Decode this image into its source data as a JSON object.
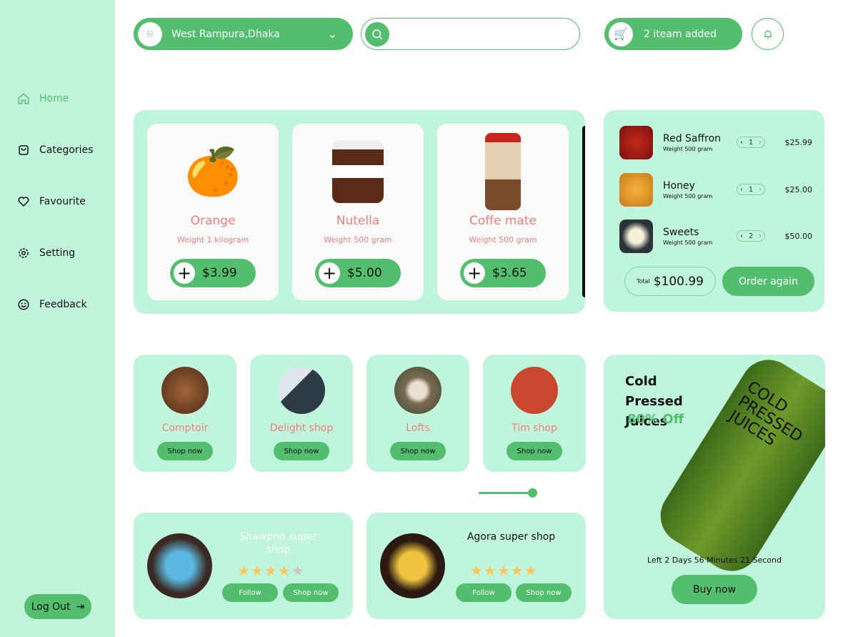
{
  "colors": {
    "accent": "#52be6e",
    "panel": "#bff5dc",
    "product_text": "#f47c7c",
    "star": "#fcc65f"
  },
  "sidebar": {
    "items": [
      {
        "label": "Home",
        "icon": "home-icon",
        "active": true
      },
      {
        "label": "Categories",
        "icon": "bag-icon"
      },
      {
        "label": "Favourite",
        "icon": "heart-icon"
      },
      {
        "label": "Setting",
        "icon": "gear-icon"
      },
      {
        "label": "Feedback",
        "icon": "smile-icon"
      }
    ],
    "logout": "Log Out"
  },
  "header": {
    "location": "West Rampura,Dhaka",
    "search_placeholder": "",
    "cart": "2 iteam added"
  },
  "products": [
    {
      "name": "Orange",
      "weight": "Weight 1 kilogram",
      "price": "$3.99"
    },
    {
      "name": "Nutella",
      "weight": "Weight 500 gram",
      "price": "$5.00"
    },
    {
      "name": "Coffe mate",
      "weight": "Weight 500 gram",
      "price": "$3.65"
    }
  ],
  "cart": {
    "items": [
      {
        "name": "Red Saffron",
        "weight": "Weight 500 gram",
        "qty": "1",
        "price": "$25.99"
      },
      {
        "name": "Honey",
        "weight": "Weight 500 gram",
        "qty": "1",
        "price": "$25.00"
      },
      {
        "name": "Sweets",
        "weight": "Weight 500 gram",
        "qty": "2",
        "price": "$50.00"
      }
    ],
    "total_label": "Total",
    "total": "$100.99",
    "order_again": "Order again"
  },
  "shops": [
    {
      "name": "Comptoir",
      "button": "Shop now"
    },
    {
      "name": "Delight shop",
      "button": "Shop now"
    },
    {
      "name": "Lofts",
      "button": "Shop now"
    },
    {
      "name": "Tim shop",
      "button": "Shop now"
    }
  ],
  "slider": {
    "value": 1.0
  },
  "supershops": [
    {
      "name": "Shawpno super shop",
      "rating": 4,
      "follow": "Follow",
      "shop": "Shop now"
    },
    {
      "name": "Agora super shop",
      "rating": 5,
      "follow": "Follow",
      "shop": "Shop now"
    }
  ],
  "promo": {
    "title": "Cold Pressed Juices",
    "discount": "80% Off",
    "timer": "Left 2 Days 56 Minutes 21 Second",
    "button": "Buy now",
    "bottle_text": "COLD PRESSED JUICES"
  }
}
